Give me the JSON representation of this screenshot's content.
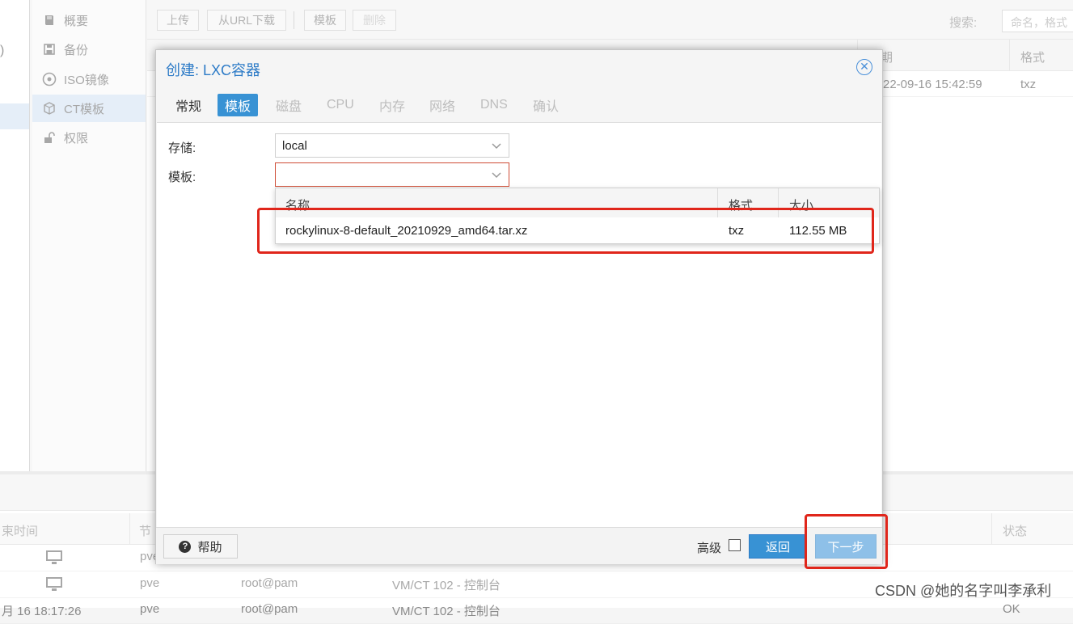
{
  "left_strip": {
    "text": ")"
  },
  "nav": {
    "items": [
      {
        "label": "概要",
        "icon": "book-icon"
      },
      {
        "label": "备份",
        "icon": "floppy-icon"
      },
      {
        "label": "ISO镜像",
        "icon": "disc-icon"
      },
      {
        "label": "CT模板",
        "icon": "cube-icon",
        "active": true
      },
      {
        "label": "权限",
        "icon": "unlock-icon"
      }
    ]
  },
  "toolbar": {
    "upload": "上传",
    "download_url": "从URL下载",
    "template": "模板",
    "delete": "删除",
    "search_label": "搜索:",
    "search_placeholder": "命名，格式"
  },
  "content_grid": {
    "col_date_partial": "期",
    "col_format": "格式",
    "row_date_partial": "22-09-16 15:42:59",
    "row_format": "txz"
  },
  "tasks": {
    "columns": [
      "束时间",
      "节",
      "状态"
    ],
    "rows": [
      {
        "node": "pve",
        "user": "",
        "desc": ""
      },
      {
        "node": "pve",
        "user": "root@pam",
        "desc": "VM/CT 102 - 控制台"
      },
      {
        "time": "月 16 18:17:26",
        "node": "pve",
        "user": "root@pam",
        "desc": "VM/CT 102 - 控制台",
        "status": "OK"
      }
    ]
  },
  "modal": {
    "title": "创建: LXC容器",
    "tabs": [
      {
        "label": "常规",
        "state": "normal"
      },
      {
        "label": "模板",
        "state": "active"
      },
      {
        "label": "磁盘",
        "state": "disabled"
      },
      {
        "label": "CPU",
        "state": "disabled"
      },
      {
        "label": "内存",
        "state": "disabled"
      },
      {
        "label": "网络",
        "state": "disabled"
      },
      {
        "label": "DNS",
        "state": "disabled"
      },
      {
        "label": "确认",
        "state": "disabled"
      }
    ],
    "storage_label": "存储:",
    "storage_value": "local",
    "template_label": "模板:",
    "template_value": "",
    "picker": {
      "columns": [
        "名称",
        "格式",
        "大小"
      ],
      "rows": [
        {
          "name": "rockylinux-8-default_20210929_amd64.tar.xz",
          "format": "txz",
          "size": "112.55 MB"
        }
      ]
    },
    "footer": {
      "help": "帮助",
      "advanced": "高级",
      "back": "返回",
      "next": "下一步"
    }
  },
  "watermark": "CSDN @她的名字叫李承利",
  "colors": {
    "accent": "#3892d4",
    "annotation_red": "#e0261b",
    "invalid_border": "#cf4c35"
  }
}
